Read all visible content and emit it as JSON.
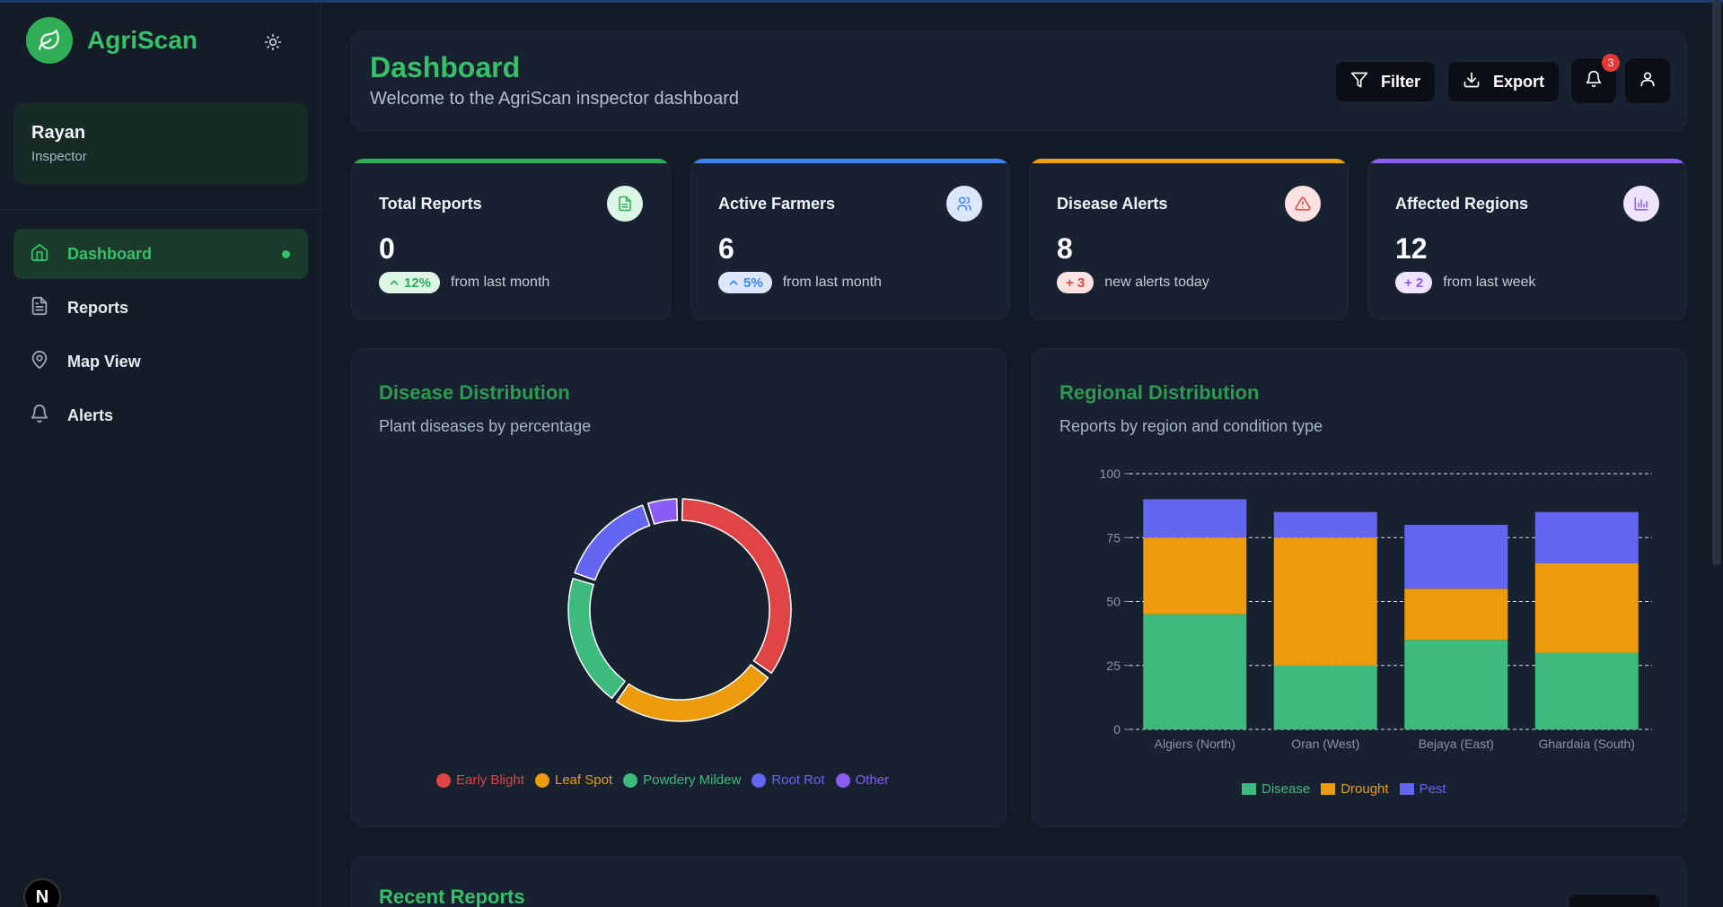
{
  "app": {
    "name": "AgriScan"
  },
  "user": {
    "name": "Rayan",
    "role": "Inspector"
  },
  "nav": [
    {
      "label": "Dashboard",
      "icon": "home-icon",
      "active": true
    },
    {
      "label": "Reports",
      "icon": "file-icon",
      "active": false
    },
    {
      "label": "Map View",
      "icon": "map-pin-icon",
      "active": false
    },
    {
      "label": "Alerts",
      "icon": "bell-icon",
      "active": false
    }
  ],
  "header": {
    "title": "Dashboard",
    "subtitle": "Welcome to the AgriScan inspector dashboard",
    "filter_label": "Filter",
    "export_label": "Export",
    "notification_count": "3"
  },
  "stats": [
    {
      "title": "Total Reports",
      "value": "0",
      "change": "12%",
      "note": "from last month",
      "accent": "#2fae55"
    },
    {
      "title": "Active Farmers",
      "value": "6",
      "change": "5%",
      "note": "from last month",
      "accent": "#3b82f6"
    },
    {
      "title": "Disease Alerts",
      "value": "8",
      "change": "+ 3",
      "note": "new alerts today",
      "accent": "#f59e0b"
    },
    {
      "title": "Affected Regions",
      "value": "12",
      "change": "+ 2",
      "note": "from last week",
      "accent": "#8b5cf6"
    }
  ],
  "disease_panel": {
    "title": "Disease Distribution",
    "subtitle": "Plant diseases by percentage"
  },
  "regional_panel": {
    "title": "Regional Distribution",
    "subtitle": "Reports by region and condition type"
  },
  "recent": {
    "title": "Recent Reports"
  },
  "colors": {
    "early_blight": "#e04444",
    "leaf_spot": "#eb9b0b",
    "powdery_mildew": "#3dba7e",
    "root_rot": "#6366f1",
    "other": "#8b5cf6",
    "disease": "#3dba7e",
    "drought": "#eb9b0b",
    "pest": "#6366f1"
  },
  "chart_data": [
    {
      "type": "pie",
      "donut": true,
      "labels": [
        "Early Blight",
        "Leaf Spot",
        "Powdery Mildew",
        "Root Rot",
        "Other"
      ],
      "values": [
        35,
        25,
        20,
        15,
        5
      ],
      "colors": [
        "#e04444",
        "#eb9b0b",
        "#3dba7e",
        "#6366f1",
        "#8b5cf6"
      ],
      "legend": "bottom"
    },
    {
      "type": "bar",
      "stacked": true,
      "categories": [
        "Algiers (North)",
        "Oran (West)",
        "Bejaya (East)",
        "Ghardaia (South)"
      ],
      "series": [
        {
          "name": "Disease",
          "values": [
            45,
            25,
            35,
            30
          ],
          "color": "#3dba7e"
        },
        {
          "name": "Drought",
          "values": [
            30,
            50,
            20,
            35
          ],
          "color": "#eb9b0b"
        },
        {
          "name": "Pest",
          "values": [
            15,
            10,
            25,
            20
          ],
          "color": "#6366f1"
        }
      ],
      "ylim": [
        0,
        100
      ],
      "yticks": [
        "0",
        "25",
        "50",
        "75",
        "100"
      ],
      "grid": true,
      "legend": "bottom"
    }
  ]
}
